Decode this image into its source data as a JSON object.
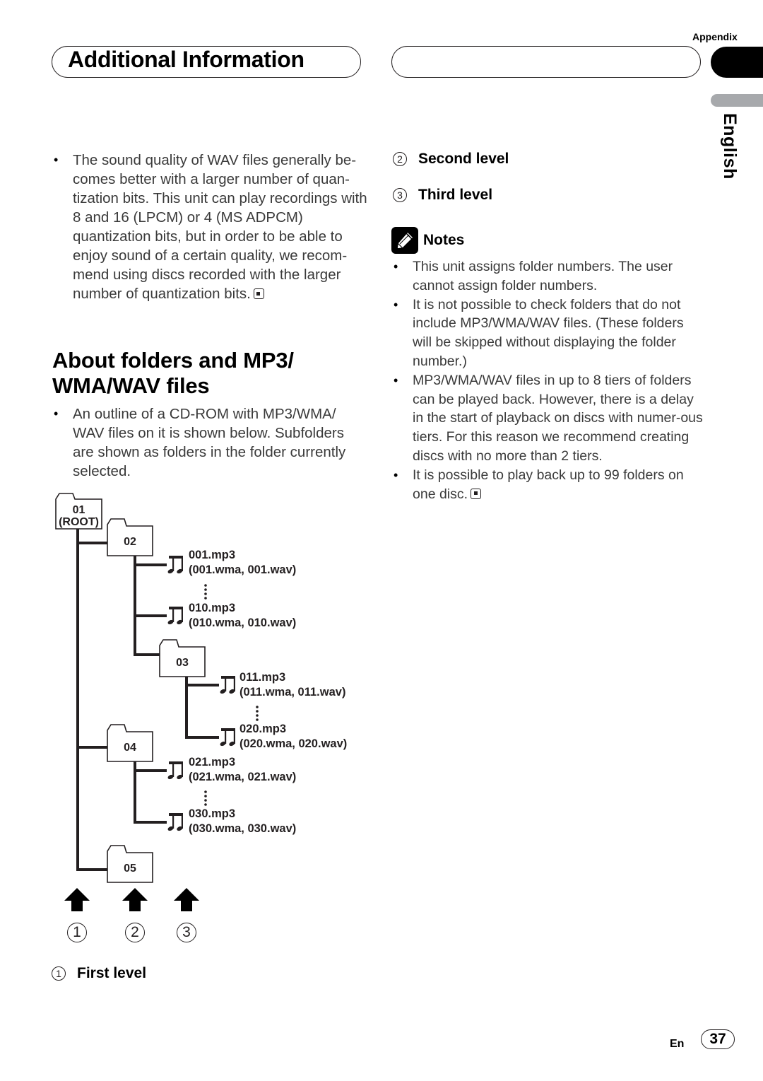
{
  "header": {
    "section_title": "Additional Information",
    "appendix_label": "Appendix",
    "language_tab": "English"
  },
  "left_column": {
    "intro_bullets": [
      {
        "text": "The sound quality of WAV files generally be-comes better with a larger number of quan-tization bits. This unit can play recordings with 8 and 16 (LPCM) or 4 (MS ADPCM) quantization bits, but in order to be able to enjoy sound of a certain quality, we recom-mend using discs recorded with the larger number of quantization bits.",
        "end_mark": true
      }
    ],
    "section_heading_line1": "About folders and MP3/",
    "section_heading_line2": "WMA/WAV files",
    "section_bullets": [
      {
        "text": "An outline of a CD-ROM with MP3/WMA/ WAV files on it is shown below. Subfolders are shown as folders in the folder currently selected."
      }
    ],
    "level_1": {
      "number": "1",
      "glyph": "①",
      "label": "First level"
    }
  },
  "diagram": {
    "icons": {
      "folder": "folder-icon",
      "file": "music-note-icon",
      "arrow": "arrow-up-icon"
    },
    "folders": [
      {
        "id": "01",
        "sub": "(ROOT)"
      },
      {
        "id": "02"
      },
      {
        "id": "03"
      },
      {
        "id": "04"
      },
      {
        "id": "05"
      }
    ],
    "files": [
      {
        "name": "001.mp3",
        "alt": "(001.wma, 001.wav)"
      },
      {
        "name": "010.mp3",
        "alt": "(010.wma, 010.wav)"
      },
      {
        "name": "011.mp3",
        "alt": "(011.wma, 011.wav)"
      },
      {
        "name": "020.mp3",
        "alt": "(020.wma, 020.wav)"
      },
      {
        "name": "021.mp3",
        "alt": "(021.wma, 021.wav)"
      },
      {
        "name": "030.mp3",
        "alt": "(030.wma, 030.wav)"
      }
    ],
    "level_markers": [
      "①",
      "②",
      "③"
    ]
  },
  "right_column": {
    "level_2": {
      "number": "2",
      "glyph": "②",
      "label": "Second level"
    },
    "level_3": {
      "number": "3",
      "glyph": "③",
      "label": "Third level"
    },
    "notes_title": "Notes",
    "notes": [
      {
        "text": "This unit assigns folder numbers. The user cannot assign folder numbers."
      },
      {
        "text": "It is not possible to check folders that do not include MP3/WMA/WAV files. (These folders will be skipped without displaying the folder number.)"
      },
      {
        "text": "MP3/WMA/WAV files in up to 8 tiers of folders can be played back. However, there is a delay in the start of playback on discs with numer-ous tiers. For this reason we recommend creating discs with no more than 2 tiers."
      },
      {
        "text": "It is possible to play back up to 99 folders on one disc.",
        "end_mark": true
      }
    ]
  },
  "footer": {
    "lang_code": "En",
    "page_number": "37"
  }
}
